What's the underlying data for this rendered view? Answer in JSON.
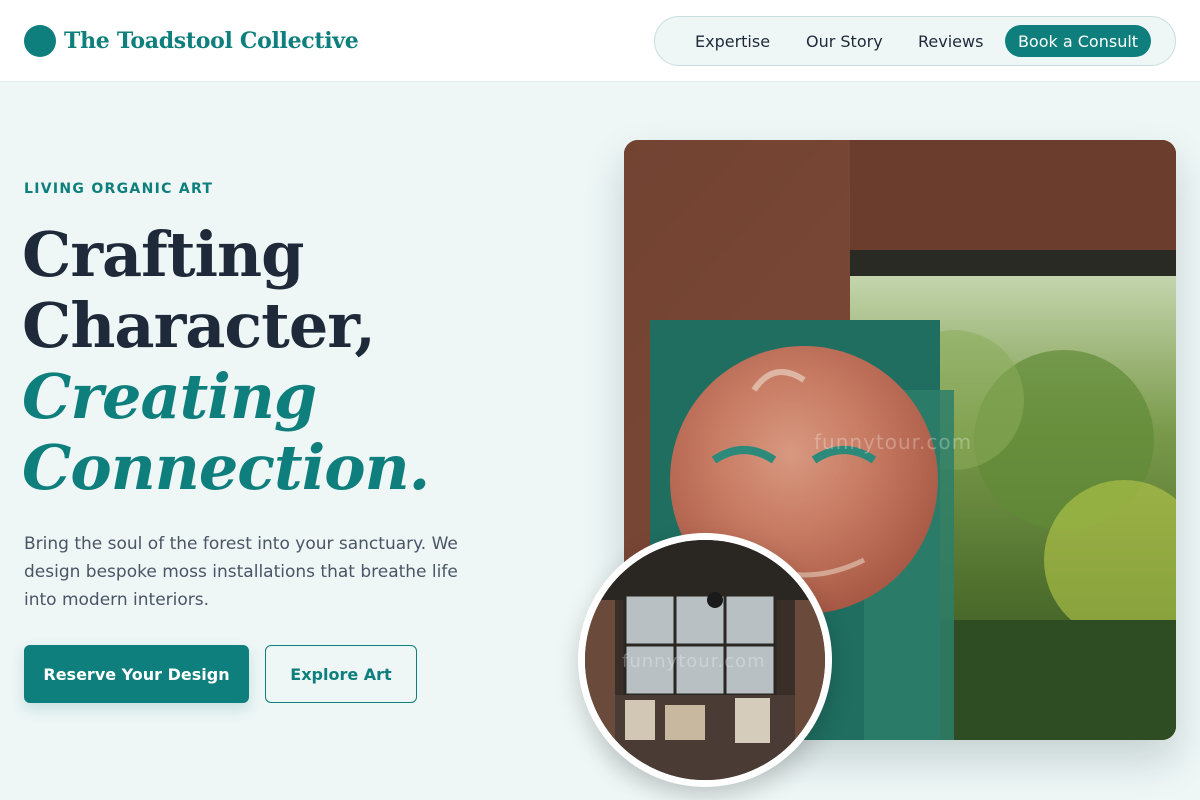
{
  "brand": {
    "name": "The Toadstool Collective"
  },
  "nav": {
    "items": [
      {
        "label": "Expertise"
      },
      {
        "label": "Our Story"
      },
      {
        "label": "Reviews"
      }
    ],
    "cta_label": "Book a Consult"
  },
  "hero": {
    "eyebrow": "LIVING ORGANIC ART",
    "headline": {
      "line1": "Crafting",
      "line2": "Character,",
      "accent_line1": "Creating",
      "accent_line2": "Connection."
    },
    "subcopy": "Bring the soul of the forest into your sanctuary. We design bespoke moss installations that breathe life into modern interiors.",
    "primary_button": "Reserve Your Design",
    "secondary_button": "Explore Art"
  },
  "images": {
    "main_watermark": "funnytour.com",
    "inset_watermark": "funnytour.com"
  },
  "colors": {
    "accent": "#0e7f7c",
    "background": "#eef6f6",
    "text_dark": "#1e2a3a",
    "text_muted": "#4a5566"
  }
}
